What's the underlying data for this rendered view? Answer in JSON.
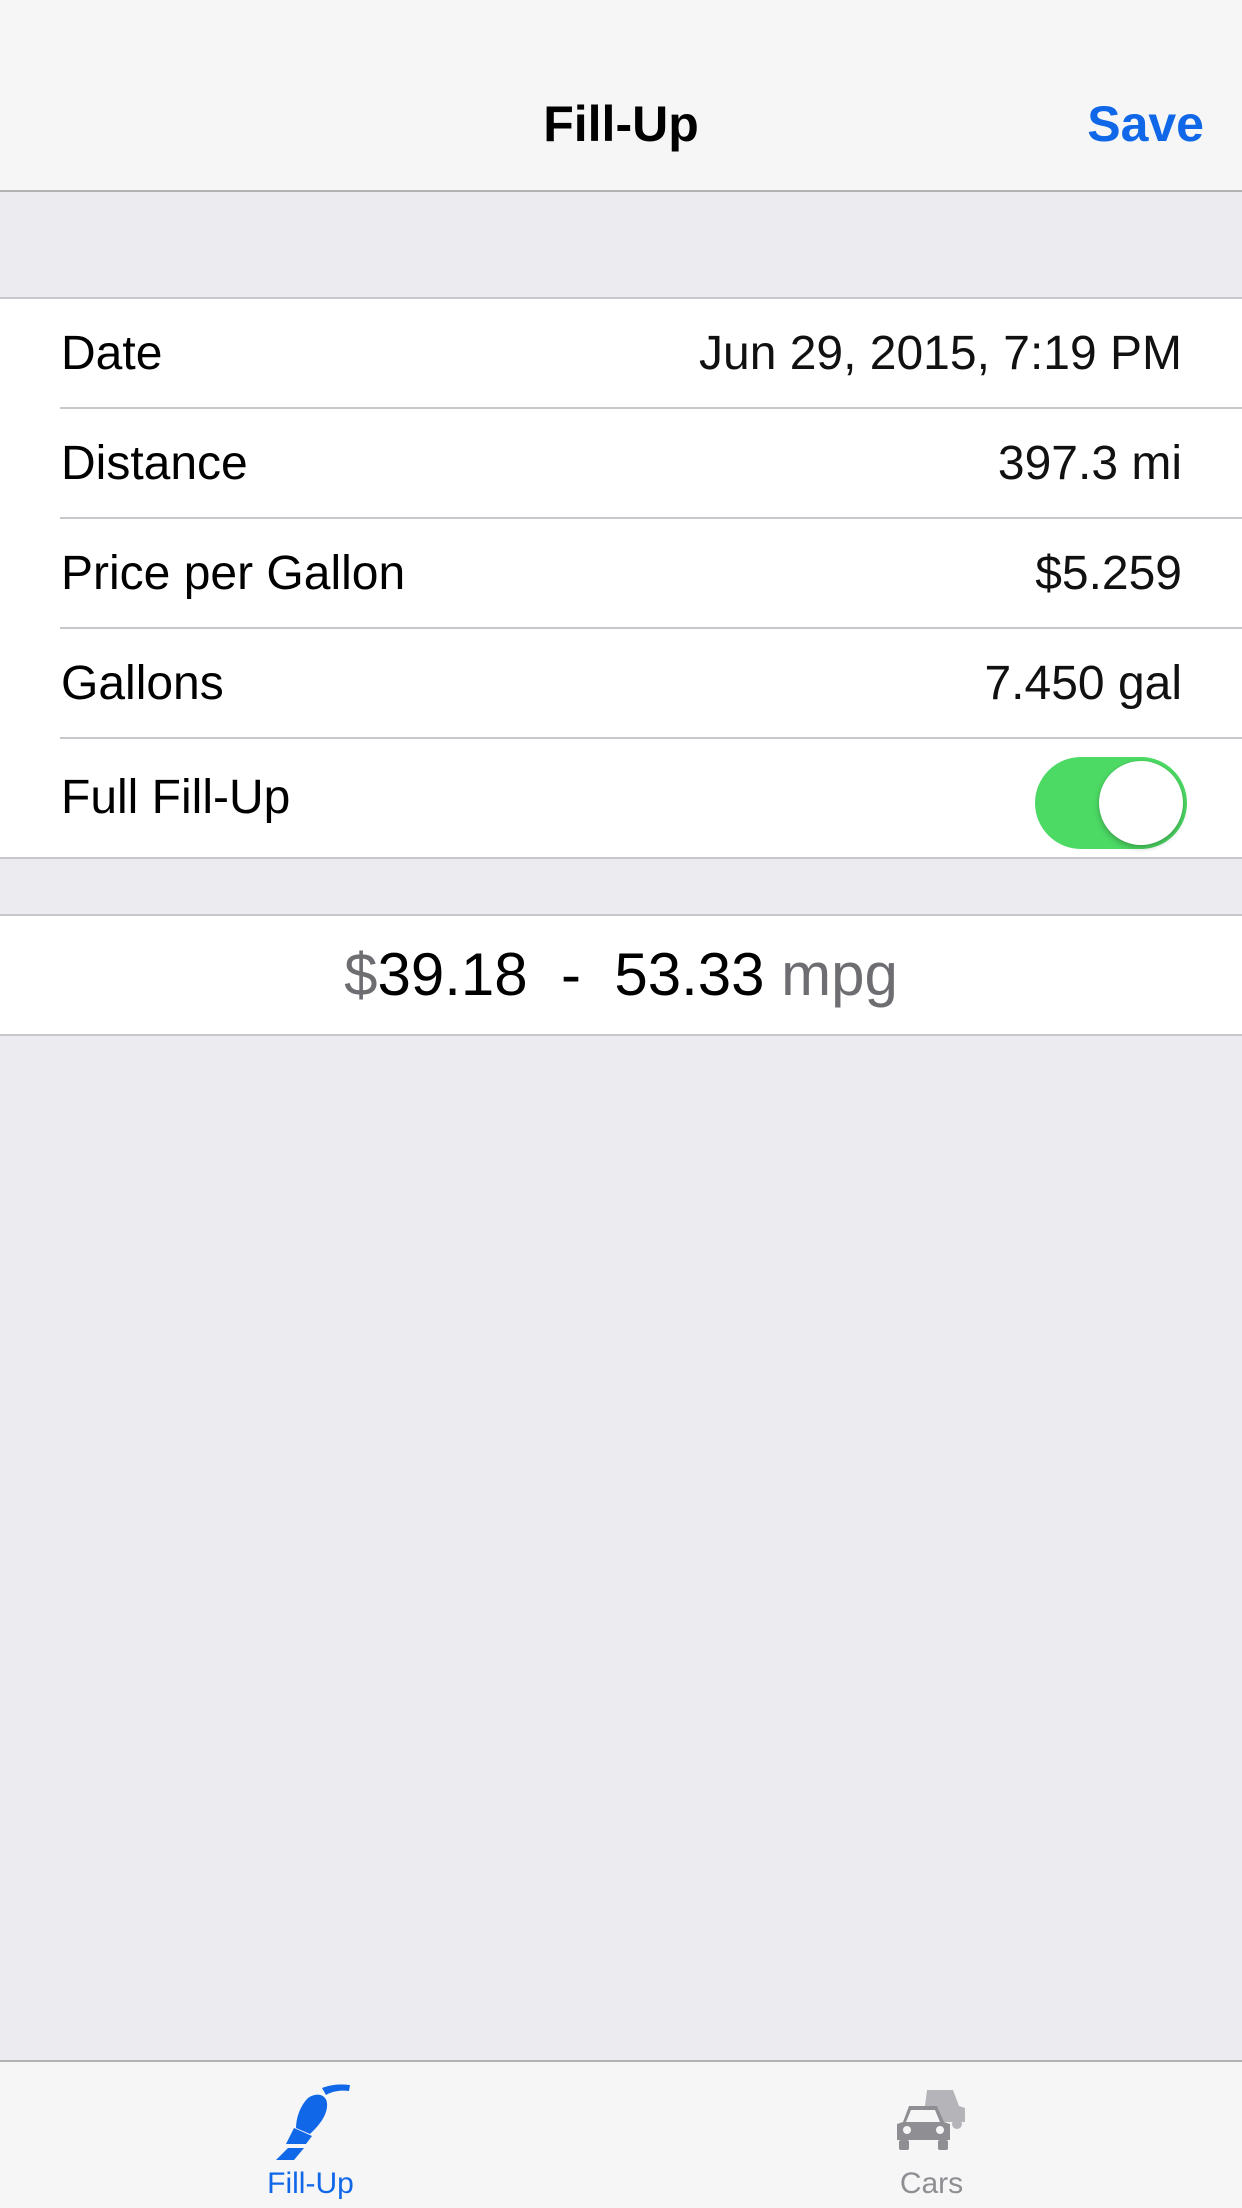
{
  "navbar": {
    "title": "Fill-Up",
    "save_label": "Save"
  },
  "form": {
    "rows": [
      {
        "label": "Date",
        "value": "Jun 29, 2015, 7:19 PM"
      },
      {
        "label": "Distance",
        "value": "397.3 mi"
      },
      {
        "label": "Price per Gallon",
        "value": "$5.259"
      },
      {
        "label": "Gallons",
        "value": "7.450 gal"
      }
    ],
    "full_fillup": {
      "label": "Full Fill-Up",
      "on": true
    }
  },
  "summary": {
    "currency_symbol": "$",
    "cost": "39.18",
    "separator": "-",
    "mpg_value": "53.33",
    "mpg_unit": "mpg"
  },
  "tabbar": {
    "tabs": [
      {
        "label": "Fill-Up",
        "icon": "fuel-nozzle-icon",
        "active": true
      },
      {
        "label": "Cars",
        "icon": "cars-icon",
        "active": false
      }
    ]
  },
  "colors": {
    "accent": "#1068e8",
    "toggle_on": "#4cd964",
    "background": "#ebebf0"
  }
}
